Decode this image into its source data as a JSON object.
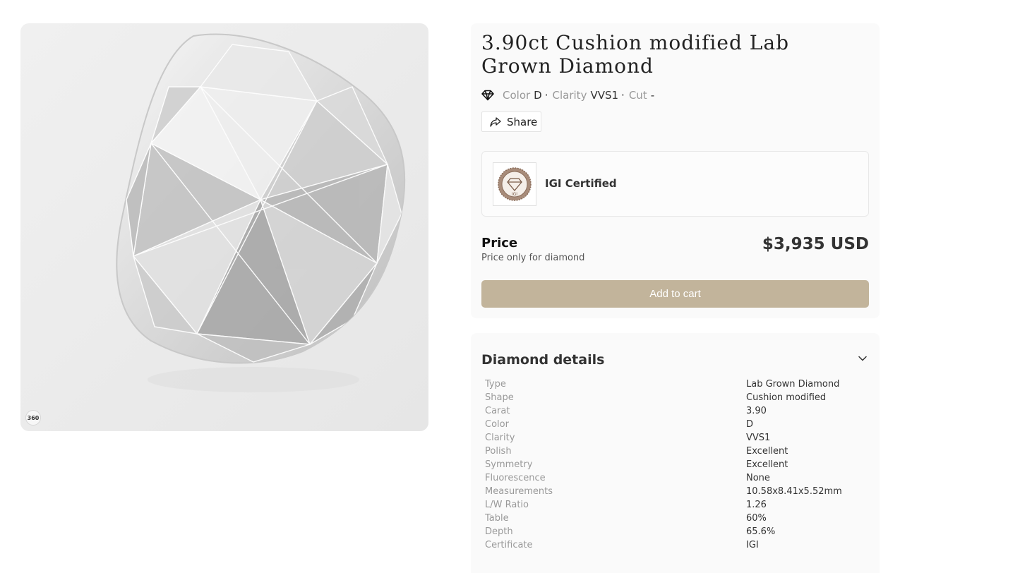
{
  "product": {
    "title": "3.90ct Cushion modified Lab Grown Diamond",
    "viewer_badge": "360"
  },
  "specs_line": {
    "color_label": "Color",
    "color_value": "D",
    "clarity_label": "Clarity",
    "clarity_value": "VVS1",
    "cut_label": "Cut",
    "cut_value": "-",
    "separator": "·"
  },
  "share_label": "Share",
  "certificate": {
    "label": "IGI Certified",
    "logo_text": "IGI"
  },
  "price": {
    "label": "Price",
    "note": "Price only for diamond",
    "value": "$3,935 USD"
  },
  "cart": {
    "label": "Add to cart",
    "color": "#c2b49b"
  },
  "details": {
    "title": "Diamond details",
    "rows": [
      {
        "key": "Type",
        "value": "Lab Grown Diamond"
      },
      {
        "key": "Shape",
        "value": "Cushion modified"
      },
      {
        "key": "Carat",
        "value": "3.90"
      },
      {
        "key": "Color",
        "value": "D"
      },
      {
        "key": "Clarity",
        "value": "VVS1"
      },
      {
        "key": "Polish",
        "value": "Excellent"
      },
      {
        "key": "Symmetry",
        "value": "Excellent"
      },
      {
        "key": "Fluorescence",
        "value": "None"
      },
      {
        "key": "Measurements",
        "value": "10.58x8.41x5.52mm"
      },
      {
        "key": "L/W Ratio",
        "value": "1.26"
      },
      {
        "key": "Table",
        "value": "60%"
      },
      {
        "key": "Depth",
        "value": "65.6%"
      },
      {
        "key": "Certificate",
        "value": "IGI"
      }
    ]
  },
  "icons": {
    "diamond": "diamond-icon",
    "share": "share-arrow-icon",
    "chevron": "chevron-down-icon",
    "rotate": "360-view-icon"
  }
}
